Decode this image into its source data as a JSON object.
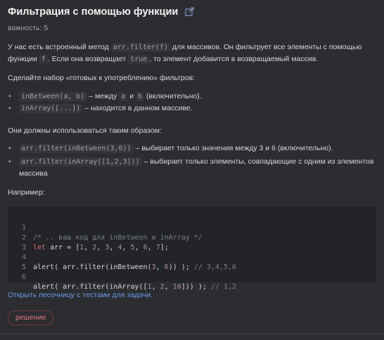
{
  "task": {
    "title": "Фильтрация с помощью функции",
    "importance_label": "важность:",
    "importance_value": "5"
  },
  "intro": {
    "t1": "У нас есть встроенный метод ",
    "c1": "arr.filter(f)",
    "t2": " для массивов. Он фильтрует все элементы с помощью функции ",
    "c2": "f",
    "t3": ". Если она возвращает ",
    "c3": "true",
    "t4": ", то элемент добавится в возвращаемый массив."
  },
  "para2": "Сделайте набор «готовых к употреблению» фильтров:",
  "filters": [
    {
      "code": "inBetween(a, b)",
      "t1": " – между ",
      "c2": "a",
      "t2": " и ",
      "c3": "b",
      "t3": " (включительно)."
    },
    {
      "code": "inArray([...])",
      "t1": " – находится в данном массиве."
    }
  ],
  "para3": "Они должны использоваться таким образом:",
  "usage": [
    {
      "code": "arr.filter(inBetween(3,6))",
      "text": " – выбирает только значения между 3 и 6 (включительно)."
    },
    {
      "code": "arr.filter(inArray([1,2,3]))",
      "text": " – выбирает только элементы, совпадающие с одним из элементов массива"
    }
  ],
  "para4": "Например:",
  "code": {
    "line_numbers": [
      "1",
      "2",
      "3",
      "4",
      "5",
      "6"
    ],
    "l1_comment": "/* .. ваш код для inBetween и inArray */",
    "l2_kw": "let",
    "l2_a": " arr = [",
    "l2_nums": [
      "1",
      "2",
      "3",
      "4",
      "5",
      "6",
      "7"
    ],
    "l2_end": "];",
    "l4_a": "alert( arr.filter(inBetween(",
    "l4_n1": "3",
    "l4_b": ", ",
    "l4_n2": "6",
    "l4_c": ")) ); ",
    "l4_comment": "// 3,4,5,6",
    "l6_a": "alert( arr.filter(inArray([",
    "l6_n1": "1",
    "l6_n2": "2",
    "l6_n3": "10",
    "l6_b": "])) ); ",
    "l6_comment": "// 1,2"
  },
  "sandbox_link": "Открыть песочницу с тестами для задачи.",
  "solution_button": "решение",
  "colors": {
    "background": "#2b2d31",
    "link": "#6c9ae8",
    "solution": "#e0777b",
    "keyword": "#e06c75",
    "number": "#b48ead"
  }
}
